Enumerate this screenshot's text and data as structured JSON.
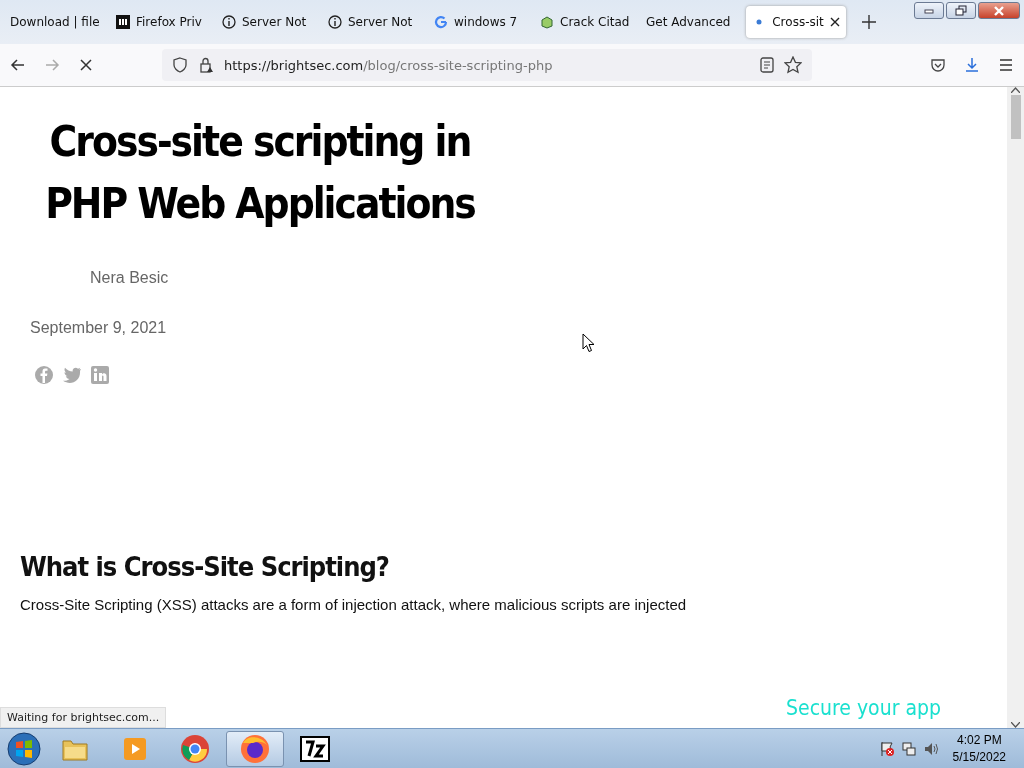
{
  "tabs": [
    {
      "label": "Download | file",
      "kind": "plain",
      "selected": false
    },
    {
      "label": "Firefox Priv",
      "kind": "mletter",
      "selected": false
    },
    {
      "label": "Server Not",
      "kind": "info",
      "selected": false
    },
    {
      "label": "Server Not",
      "kind": "info",
      "selected": false
    },
    {
      "label": "windows 7",
      "kind": "google",
      "selected": false
    },
    {
      "label": "Crack Citad",
      "kind": "box",
      "selected": false
    },
    {
      "label": "Get Advanced",
      "kind": "plain",
      "selected": false
    },
    {
      "label": "Cross-sit",
      "kind": "loading",
      "selected": true
    }
  ],
  "address": {
    "host": "https://brightsec.com",
    "path": "/blog/cross-site-scripting-php",
    "loading": true
  },
  "article": {
    "title": "Cross-site scripting in PHP Web Applications",
    "author": "Nera Besic",
    "date": "September 9, 2021",
    "heading": "What is Cross-Site Scripting?",
    "paragraph": "Cross-Site Scripting (XSS) attacks are a form of injection attack, where malicious scripts are injected",
    "promo": "Secure your app"
  },
  "status_bar": "Waiting for brightsec.com...",
  "clock": {
    "time": "4:02 PM",
    "date": "5/15/2022"
  },
  "taskbar": [
    {
      "kind": "folder",
      "active": false
    },
    {
      "kind": "media",
      "active": false
    },
    {
      "kind": "chrome",
      "active": false
    },
    {
      "kind": "firefox",
      "active": true
    },
    {
      "kind": "archive",
      "active": false
    }
  ]
}
